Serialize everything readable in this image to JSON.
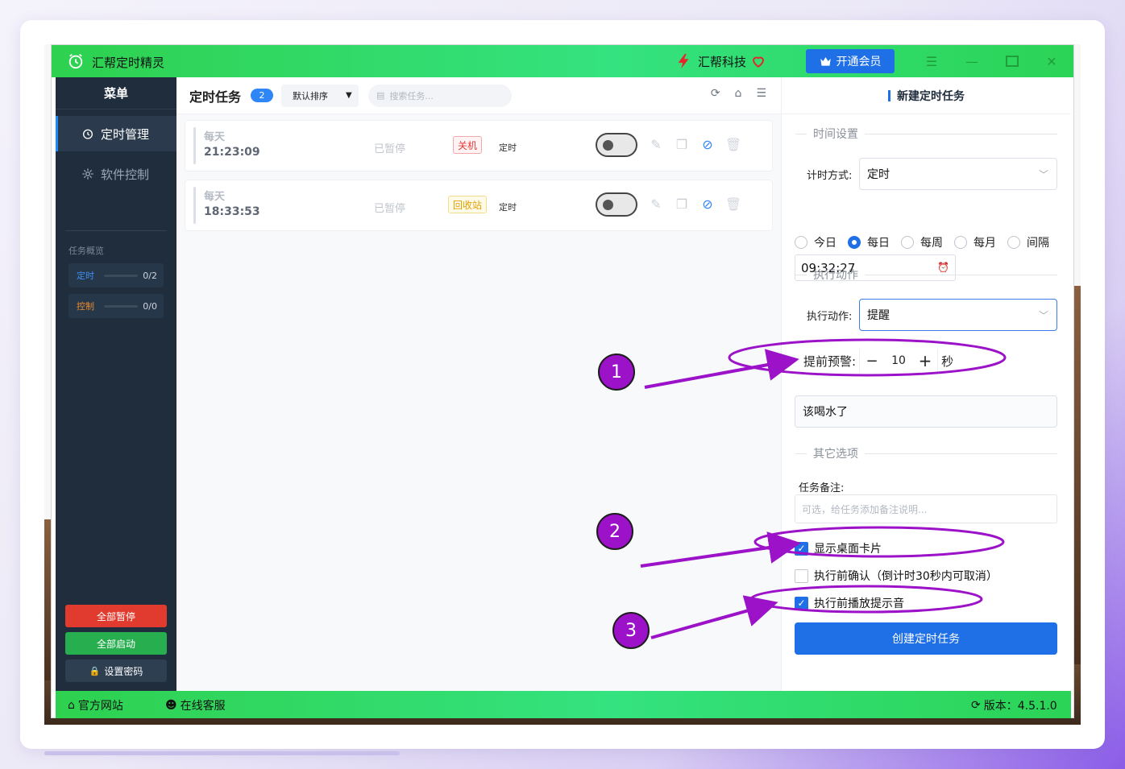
{
  "app": {
    "title": "汇帮定时精灵",
    "brand": "汇帮科技",
    "vip_label": "开通会员"
  },
  "sidebar": {
    "header": "菜单",
    "items": [
      {
        "label": "定时管理",
        "icon": "alarm-clock-icon",
        "active": true
      },
      {
        "label": "软件控制",
        "icon": "gear-icon",
        "active": false
      }
    ],
    "overview_title": "任务概览",
    "overview": [
      {
        "label": "定时",
        "count": "0/2",
        "color": "#3d8ff0"
      },
      {
        "label": "控制",
        "count": "0/0",
        "color": "#e88a2d"
      }
    ],
    "buttons": {
      "pause_all": "全部暂停",
      "start_all": "全部启动",
      "set_password": "设置密码"
    }
  },
  "main": {
    "title": "定时任务",
    "count": "2",
    "sort_label": "默认排序",
    "search_placeholder": "搜索任务...",
    "tasks": [
      {
        "freq": "每天",
        "time": "21:23:09",
        "status": "已暂停",
        "action": "关机",
        "action_color": "red",
        "kind": "定时",
        "enabled": false
      },
      {
        "freq": "每天",
        "time": "18:33:53",
        "status": "已暂停",
        "action": "回收站",
        "action_color": "yellow",
        "kind": "定时",
        "enabled": false
      }
    ]
  },
  "panel": {
    "title": "新建定时任务",
    "section_time": "时间设置",
    "timing_mode_label": "计时方式:",
    "timing_mode_value": "定时",
    "radios": [
      {
        "label": "今日",
        "checked": false
      },
      {
        "label": "每日",
        "checked": true
      },
      {
        "label": "每周",
        "checked": false
      },
      {
        "label": "每月",
        "checked": false
      },
      {
        "label": "间隔",
        "checked": false
      }
    ],
    "time_value": "09:32:27",
    "section_action": "执行动作",
    "action_label": "执行动作:",
    "action_value": "提醒",
    "advance_label": "提前预警:",
    "advance_minus": "−",
    "advance_value": "10",
    "advance_plus": "+",
    "advance_unit": "秒",
    "reminder_text": "该喝水了",
    "section_other": "其它选项",
    "note_label": "任务备注:",
    "note_placeholder": "可选，给任务添加备注说明...",
    "checks": [
      {
        "label": "显示桌面卡片",
        "checked": true
      },
      {
        "label": "执行前确认（倒计时30秒内可取消）",
        "checked": false
      },
      {
        "label": "执行前播放提示音",
        "checked": true
      }
    ],
    "create_label": "创建定时任务"
  },
  "statusbar": {
    "website": "官方网站",
    "support": "在线客服",
    "version": "版本：4.5.1.0"
  },
  "annotations": {
    "n1": "1",
    "n2": "2",
    "n3": "3",
    "color": "#9b12c8"
  }
}
